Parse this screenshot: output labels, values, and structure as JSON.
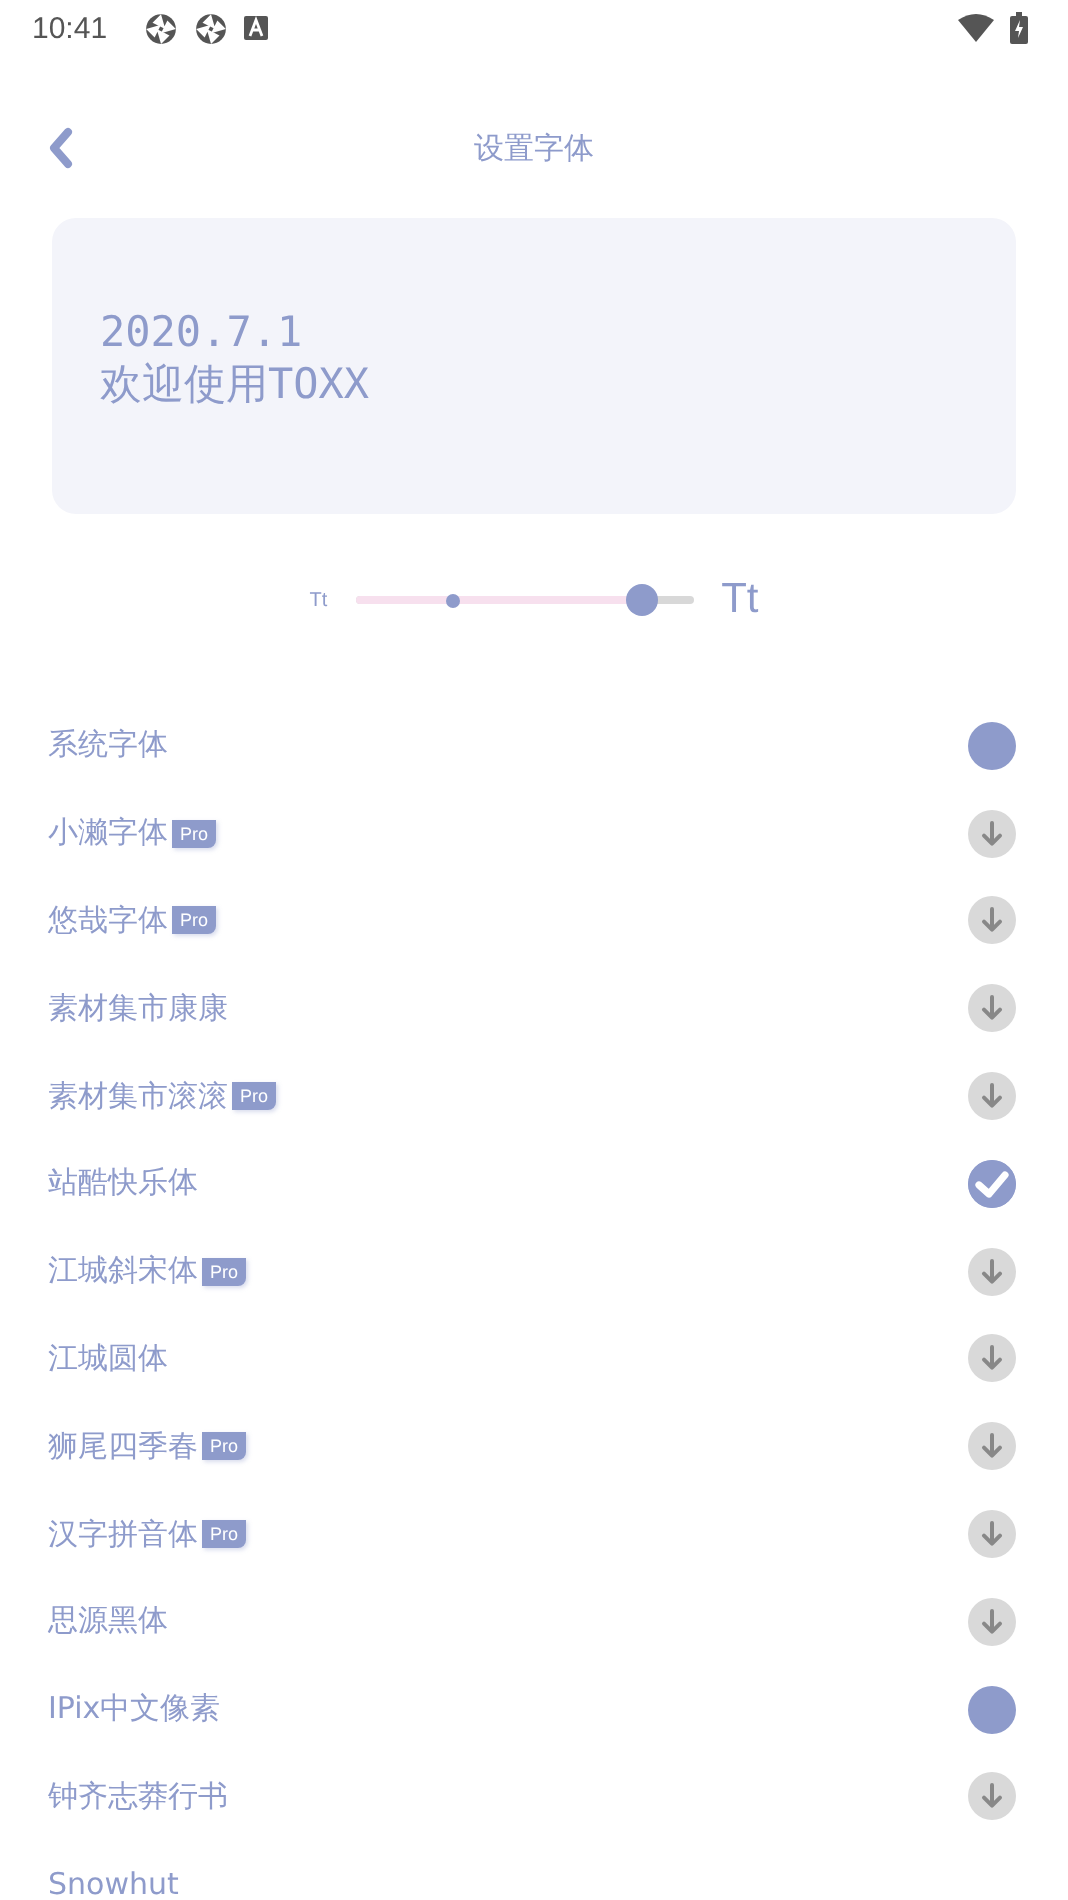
{
  "status_bar": {
    "time": "10:41"
  },
  "header": {
    "title": "设置字体"
  },
  "preview": {
    "lines": [
      "2020.7.1",
      "欢迎使用TOXX"
    ]
  },
  "size_slider": {
    "small_label": "Tt",
    "large_label": "Tt",
    "level": 0.85
  },
  "fonts": [
    {
      "name": "系统字体",
      "downloaded": true,
      "selected": false
    },
    {
      "name": "小濑字体",
      "badge": "Pro",
      "downloaded": false,
      "selected": false
    },
    {
      "name": "悠哉字体",
      "badge": "Pro",
      "downloaded": false,
      "selected": false
    },
    {
      "name": "素材集市康康",
      "downloaded": false,
      "selected": false
    },
    {
      "name": "素材集市滚滚",
      "badge": "Pro",
      "downloaded": false,
      "selected": false
    },
    {
      "name": "站酷快乐体",
      "downloaded": true,
      "selected": true
    },
    {
      "name": "江城斜宋体",
      "badge": "Pro",
      "downloaded": false,
      "selected": false
    },
    {
      "name": "江城圆体",
      "downloaded": false,
      "selected": false
    },
    {
      "name": "狮尾四季春",
      "badge": "Pro",
      "downloaded": false,
      "selected": false
    },
    {
      "name": "汉字拼音体",
      "badge": "Pro",
      "downloaded": false,
      "selected": false
    },
    {
      "name": "思源黑体",
      "downloaded": false,
      "selected": false
    },
    {
      "name": "IPix中文像素",
      "downloaded": true,
      "selected": false
    },
    {
      "name": "钟齐志莽行书",
      "downloaded": false,
      "selected": false
    },
    {
      "name": "Snowhut"
    }
  ]
}
